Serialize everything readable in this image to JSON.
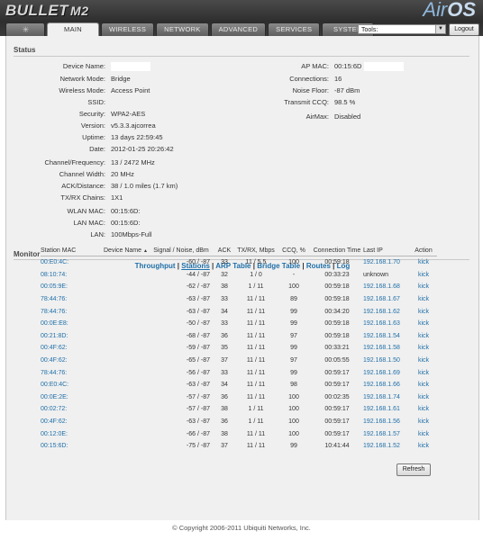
{
  "header": {
    "logo": "BULLET",
    "model": "M2",
    "brand_prefix": "Air",
    "brand_suffix": "OS",
    "tabs": [
      {
        "label": "",
        "icon": "ubnt-logo-icon"
      },
      {
        "label": "MAIN"
      },
      {
        "label": "WIRELESS"
      },
      {
        "label": "NETWORK"
      },
      {
        "label": "ADVANCED"
      },
      {
        "label": "SERVICES"
      },
      {
        "label": "SYSTEM"
      }
    ],
    "active_tab": "MAIN",
    "tools_select": "Tools:",
    "logout": "Logout"
  },
  "status": {
    "title": "Status",
    "left": [
      {
        "label": "Device Name:",
        "value": ""
      },
      {
        "label": "Network Mode:",
        "value": "Bridge"
      },
      {
        "label": "Wireless Mode:",
        "value": "Access Point"
      },
      {
        "label": "SSID:",
        "value": ""
      },
      {
        "label": "Security:",
        "value": "WPA2-AES"
      },
      {
        "label": "Version:",
        "value": "v5.3.3.ajcorrea"
      },
      {
        "label": "Uptime:",
        "value": "13 days 22:59:45"
      },
      {
        "label": "Date:",
        "value": "2012-01-25 20:26:42"
      },
      {
        "label": "Channel/Frequency:",
        "value": "13 / 2472 MHz"
      },
      {
        "label": "Channel Width:",
        "value": "20 MHz"
      },
      {
        "label": "ACK/Distance:",
        "value": "38 / 1.0 miles (1.7 km)"
      },
      {
        "label": "TX/RX Chains:",
        "value": "1X1"
      },
      {
        "label": "WLAN MAC:",
        "value": "00:15:6D:"
      },
      {
        "label": "LAN MAC:",
        "value": "00:15:6D:"
      },
      {
        "label": "LAN:",
        "value": "100Mbps-Full"
      }
    ],
    "right": [
      {
        "label": "AP MAC:",
        "value": "00:15:6D"
      },
      {
        "label": "Connections:",
        "value": "16"
      },
      {
        "label": "Noise Floor:",
        "value": "-87 dBm"
      },
      {
        "label": "Transmit CCQ:",
        "value": "98.5 %"
      },
      {
        "label": "AirMax:",
        "value": "Disabled"
      }
    ]
  },
  "monitor": {
    "title": "Monitor",
    "links": [
      "Throughput",
      "Stations",
      "ARP Table",
      "Bridge Table",
      "Routes",
      "Log"
    ],
    "active_link": "Stations",
    "separator": "|",
    "columns": [
      "Station MAC",
      "Device Name",
      "Signal / Noise, dBm",
      "ACK",
      "TX/RX, Mbps",
      "CCQ, %",
      "Connection Time",
      "Last IP",
      "Action"
    ],
    "sort_indicator": "▲",
    "rows": [
      [
        "00:E0:4C:",
        "",
        "-60 / -87",
        "33",
        "11 / 5.5",
        "100",
        "00:59:18",
        "192.168.1.70",
        "kick"
      ],
      [
        "08:10:74:",
        "",
        "-44 / -87",
        "32",
        "1 / 0",
        "-",
        "00:33:23",
        "unknown",
        "kick"
      ],
      [
        "00:05:9E:",
        "",
        "-62 / -87",
        "38",
        "1 / 11",
        "100",
        "00:59:18",
        "192.168.1.68",
        "kick"
      ],
      [
        "78:44:76:",
        "",
        "-63 / -87",
        "33",
        "11 / 11",
        "89",
        "00:59:18",
        "192.168.1.67",
        "kick"
      ],
      [
        "78:44:76:",
        "",
        "-63 / -87",
        "34",
        "11 / 11",
        "99",
        "00:34:20",
        "192.168.1.62",
        "kick"
      ],
      [
        "00:0E:E8:",
        "",
        "-50 / -87",
        "33",
        "11 / 11",
        "99",
        "00:59:18",
        "192.168.1.63",
        "kick"
      ],
      [
        "00:21:8D:",
        "",
        "-68 / -87",
        "36",
        "11 / 11",
        "97",
        "00:59:18",
        "192.168.1.54",
        "kick"
      ],
      [
        "00:4F:62:",
        "",
        "-59 / -87",
        "35",
        "11 / 11",
        "99",
        "00:33:21",
        "192.168.1.58",
        "kick"
      ],
      [
        "00:4F:62:",
        "",
        "-65 / -87",
        "37",
        "11 / 11",
        "97",
        "00:05:55",
        "192.168.1.50",
        "kick"
      ],
      [
        "78:44:76:",
        "",
        "-56 / -87",
        "33",
        "11 / 11",
        "99",
        "00:59:17",
        "192.168.1.69",
        "kick"
      ],
      [
        "00:E0:4C:",
        "",
        "-63 / -87",
        "34",
        "11 / 11",
        "98",
        "00:59:17",
        "192.168.1.66",
        "kick"
      ],
      [
        "00:0E:2E:",
        "",
        "-57 / -87",
        "36",
        "11 / 11",
        "100",
        "00:02:35",
        "192.168.1.74",
        "kick"
      ],
      [
        "00:02:72:",
        "",
        "-57 / -87",
        "38",
        "1 / 11",
        "100",
        "00:59:17",
        "192.168.1.61",
        "kick"
      ],
      [
        "00:4F:62:",
        "",
        "-63 / -87",
        "36",
        "1 / 11",
        "100",
        "00:59:17",
        "192.168.1.56",
        "kick"
      ],
      [
        "00:12:0E:",
        "",
        "-66 / -87",
        "38",
        "11 / 11",
        "100",
        "00:59:17",
        "192.168.1.57",
        "kick"
      ],
      [
        "00:15:6D:",
        "",
        "-75 / -87",
        "37",
        "11 / 11",
        "99",
        "10:41:44",
        "192.168.1.52",
        "kick"
      ]
    ],
    "refresh": "Refresh"
  },
  "footer": "© Copyright 2006-2011 Ubiquiti Networks, Inc.",
  "colors": {
    "link": "#1f6fa8",
    "header": "#3a3a3a",
    "panel": "#f0f0f0"
  }
}
